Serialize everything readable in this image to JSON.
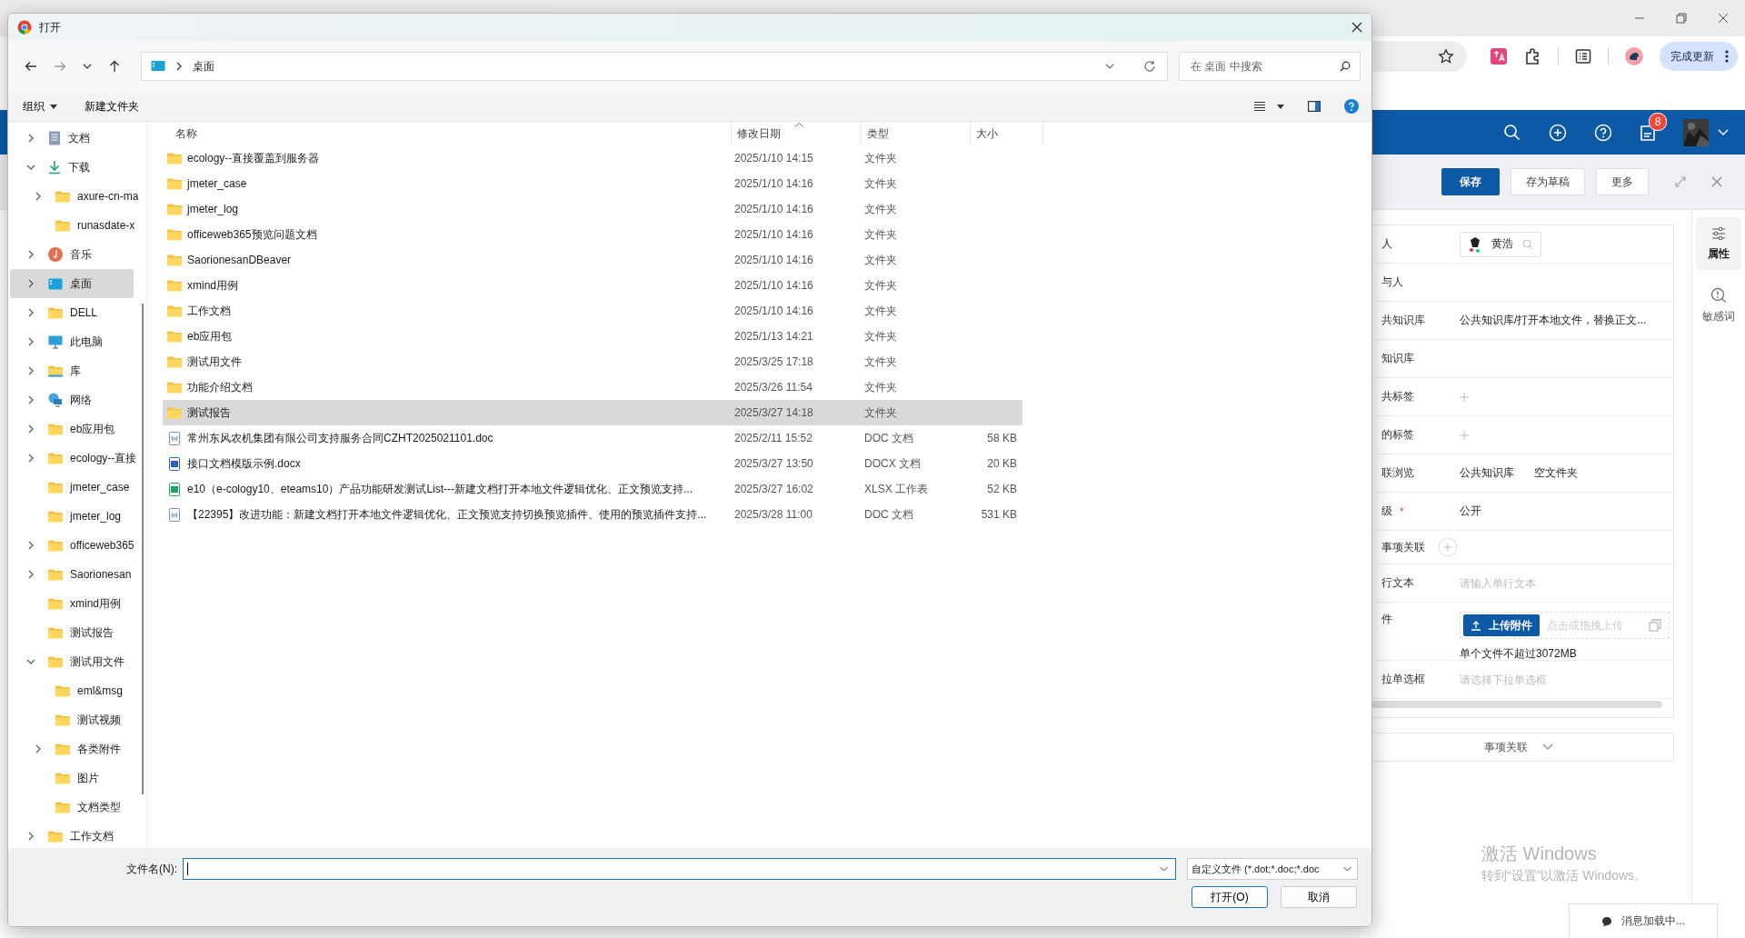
{
  "browser": {
    "update_button": "完成更新"
  },
  "app": {
    "badge": "8",
    "actions": [
      {
        "label": "保存",
        "kind": "primary"
      },
      {
        "label": "存为草稿",
        "kind": "default"
      },
      {
        "label": "更多",
        "kind": "default"
      }
    ],
    "form_rows": [
      {
        "label": "人",
        "kind": "person",
        "value": "黄浩"
      },
      {
        "label": "与人",
        "kind": "empty"
      },
      {
        "label": "共知识库",
        "kind": "text",
        "value": "公共知识库/打开本地文件，替换正文..."
      },
      {
        "label": "知识库",
        "kind": "empty"
      },
      {
        "label": "共标签",
        "kind": "add"
      },
      {
        "label": "的标签",
        "kind": "add"
      },
      {
        "label": "联浏览",
        "kind": "chips",
        "values": [
          "公共知识库",
          "空文件夹"
        ]
      },
      {
        "label": "级",
        "kind": "text",
        "required_mark": "*",
        "value": "公开"
      },
      {
        "label": "事项关联",
        "kind": "relation"
      },
      {
        "label": "行文本",
        "kind": "placeholder",
        "placeholder": "请输入单行文本"
      },
      {
        "label": "件",
        "kind": "upload",
        "button": "上传附件",
        "hint": "点击或拖拽上传",
        "note": "单个文件不超过3072MB"
      },
      {
        "label": "拉单选框",
        "kind": "placeholder",
        "placeholder": "请选择下拉单选框"
      }
    ],
    "collapse_bar": "事项关联",
    "side_tabs": [
      {
        "label": "属性",
        "selected": true
      },
      {
        "label": "敏感词",
        "selected": false
      }
    ]
  },
  "windows_notice": {
    "title": "激活 Windows",
    "subtitle": "转到“设置”以激活 Windows。"
  },
  "toast": "消息加载中...",
  "dialog": {
    "title": "打开",
    "path": "桌面",
    "search": {
      "placeholder": "在 桌面 中搜索"
    },
    "toolbar": [
      {
        "label": "组织",
        "menu": true
      },
      {
        "label": "新建文件夹",
        "menu": false
      }
    ],
    "tree": [
      {
        "label": "文档",
        "kind": "doc",
        "expanded": false,
        "selected": false
      },
      {
        "label": "下载",
        "kind": "download",
        "expanded": true,
        "selected": false,
        "children": [
          {
            "label": "axure-cn-ma",
            "kind": "folder",
            "expanded": false,
            "selected": false
          },
          {
            "label": "runasdate-x",
            "kind": "folder",
            "selected": false
          }
        ]
      },
      {
        "label": "音乐",
        "kind": "music",
        "expanded": false,
        "selected": false
      },
      {
        "label": "桌面",
        "kind": "desktop",
        "expanded": false,
        "selected": true
      },
      {
        "label": "DELL",
        "kind": "folder",
        "expanded": false,
        "selected": false
      },
      {
        "label": "此电脑",
        "kind": "pc",
        "expanded": false,
        "selected": false
      },
      {
        "label": "库",
        "kind": "library",
        "expanded": false,
        "selected": false
      },
      {
        "label": "网络",
        "kind": "network",
        "expanded": false,
        "selected": false
      },
      {
        "label": "eb应用包",
        "kind": "folder",
        "expanded": false,
        "selected": false
      },
      {
        "label": "ecology--直接",
        "kind": "folder",
        "expanded": false,
        "selected": false
      },
      {
        "label": "jmeter_case",
        "kind": "folder",
        "selected": false
      },
      {
        "label": "jmeter_log",
        "kind": "folder",
        "selected": false
      },
      {
        "label": "officeweb365",
        "kind": "folder",
        "expanded": false,
        "selected": false
      },
      {
        "label": "Saorionesan",
        "kind": "folder",
        "expanded": false,
        "selected": false
      },
      {
        "label": "xmind用例",
        "kind": "folder",
        "selected": false
      },
      {
        "label": "测试报告",
        "kind": "folder",
        "selected": false
      },
      {
        "label": "测试用文件",
        "kind": "folder",
        "expanded": true,
        "selected": false,
        "children": [
          {
            "label": "eml&msg",
            "kind": "folder",
            "selected": false
          },
          {
            "label": "测试视频",
            "kind": "folder",
            "selected": false
          },
          {
            "label": "各类附件",
            "kind": "folder",
            "expanded": false,
            "selected": false
          },
          {
            "label": "图片",
            "kind": "folder",
            "selected": false
          },
          {
            "label": "文档类型",
            "kind": "folder",
            "selected": false
          }
        ]
      },
      {
        "label": "工作文档",
        "kind": "folder",
        "expanded": false,
        "selected": false
      }
    ],
    "columns": [
      "名称",
      "修改日期",
      "类型",
      "大小"
    ],
    "files": [
      {
        "name": "ecology--直接覆盖到服务器",
        "date": "2025/1/10 14:15",
        "type": "文件夹",
        "kind": "folder",
        "selected": false
      },
      {
        "name": "jmeter_case",
        "date": "2025/1/10 14:16",
        "type": "文件夹",
        "kind": "folder",
        "selected": false
      },
      {
        "name": "jmeter_log",
        "date": "2025/1/10 14:16",
        "type": "文件夹",
        "kind": "folder",
        "selected": false
      },
      {
        "name": "officeweb365预览问题文档",
        "date": "2025/1/10 14:16",
        "type": "文件夹",
        "kind": "folder",
        "selected": false
      },
      {
        "name": "SaorionesanDBeaver",
        "date": "2025/1/10 14:16",
        "type": "文件夹",
        "kind": "folder",
        "selected": false
      },
      {
        "name": "xmind用例",
        "date": "2025/1/10 14:16",
        "type": "文件夹",
        "kind": "folder",
        "selected": false
      },
      {
        "name": "工作文档",
        "date": "2025/1/10 14:16",
        "type": "文件夹",
        "kind": "folder",
        "selected": false
      },
      {
        "name": "eb应用包",
        "date": "2025/1/13 14:21",
        "type": "文件夹",
        "kind": "folder",
        "selected": false
      },
      {
        "name": "测试用文件",
        "date": "2025/3/25 17:18",
        "type": "文件夹",
        "kind": "folder",
        "selected": false
      },
      {
        "name": "功能介绍文档",
        "date": "2025/3/26 11:54",
        "type": "文件夹",
        "kind": "folder",
        "selected": false
      },
      {
        "name": "测试报告",
        "date": "2025/3/27 14:18",
        "type": "文件夹",
        "kind": "folder",
        "selected": true
      },
      {
        "name": "常州东风农机集团有限公司支持服务合同CZHT2025021101.doc",
        "date": "2025/2/11 15:52",
        "type": "DOC 文档",
        "size": "58 KB",
        "kind": "doc",
        "selected": false
      },
      {
        "name": "接口文档模版示例.docx",
        "date": "2025/3/27 13:50",
        "type": "DOCX 文档",
        "size": "20 KB",
        "kind": "docx",
        "selected": false
      },
      {
        "name": "e10（e-cology10、eteams10）产品功能研发测试List---新建文档打开本地文件逻辑优化、正文预览支持...",
        "date": "2025/3/27 16:02",
        "type": "XLSX 工作表",
        "size": "52 KB",
        "kind": "xlsx",
        "selected": false
      },
      {
        "name": "【22395】改进功能：新建文档打开本地文件逻辑优化、正文预览支持切换预览插件、使用的预览插件支持...",
        "date": "2025/3/28 11:00",
        "type": "DOC 文档",
        "size": "531 KB",
        "kind": "doc",
        "selected": false
      }
    ],
    "filename_label": "文件名(N):",
    "filter": "自定义文件 (*.dot;*.doc;*.doc",
    "buttons": [
      {
        "label": "打开(O)",
        "kind": "default"
      },
      {
        "label": "取消",
        "kind": "normal"
      }
    ]
  }
}
